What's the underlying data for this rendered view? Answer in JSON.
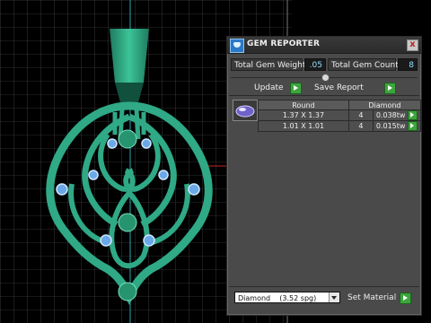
{
  "panel": {
    "title": "GEM REPORTER",
    "close_label": "x",
    "total_weight_label": "Total Gem Weight",
    "total_weight_value": ".05",
    "total_count_label": "Total Gem Count",
    "total_count_value": "8",
    "update_label": "Update",
    "save_report_label": "Save Report",
    "table": {
      "headers": [
        "Round",
        "Diamond"
      ],
      "rows": [
        {
          "size": "1.37 X 1.37",
          "count": "4",
          "weight": "0.038tw"
        },
        {
          "size": "1.01 X 1.01",
          "count": "4",
          "weight": "0.015tw"
        }
      ]
    },
    "material_value": "Diamond    (3.52 spg)",
    "set_material_label": "Set Material"
  },
  "colors": {
    "pendant": "#2fa986",
    "pendant_dark": "#1c6e55",
    "accent_green": "#3ca53c",
    "value_text": "#8fe0ff"
  }
}
